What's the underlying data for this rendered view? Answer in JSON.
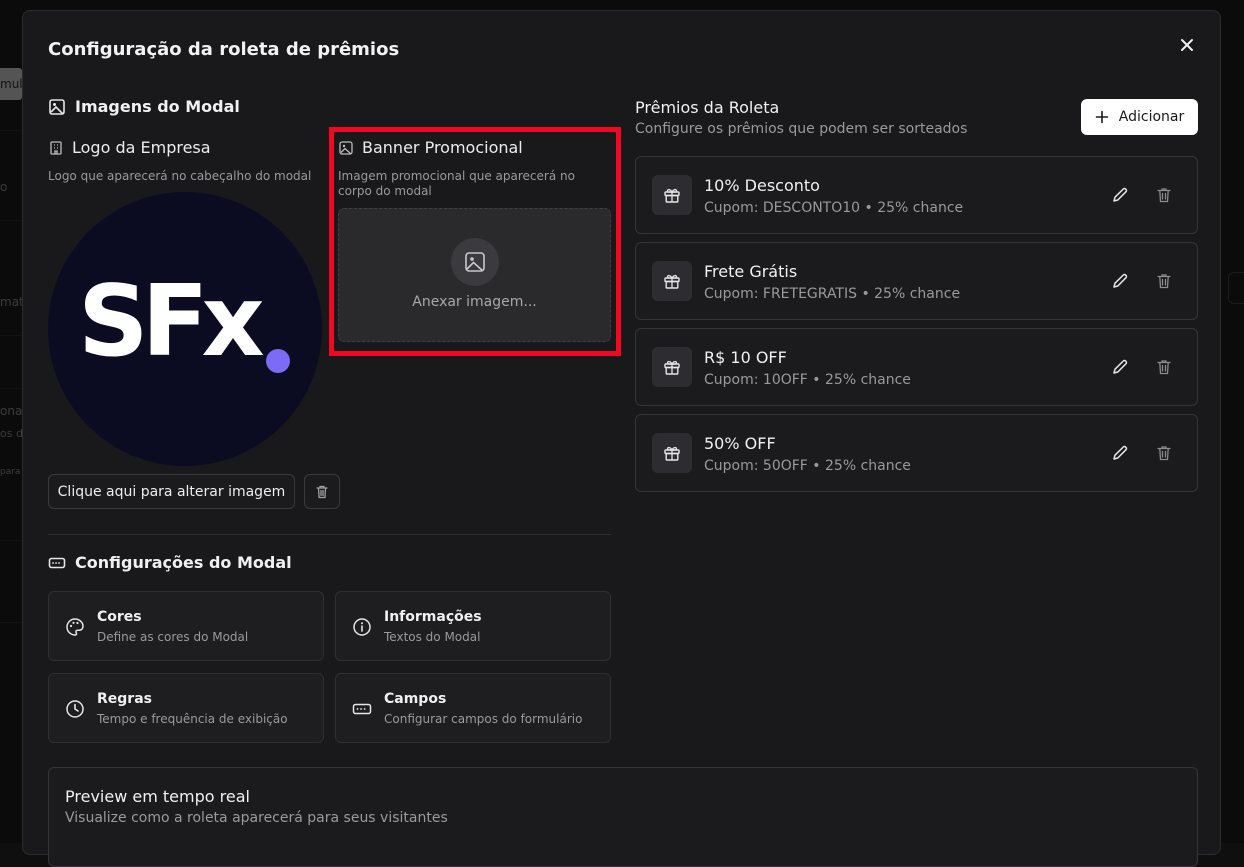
{
  "background": {
    "fragments": [
      "mul",
      "o",
      "mati",
      "ona",
      "os d",
      "para"
    ]
  },
  "modal": {
    "title": "Configuração da roleta de prêmios",
    "images_section": {
      "title": "Imagens do Modal",
      "logo": {
        "label": "Logo da Empresa",
        "hint": "Logo que aparecerá no cabeçalho do modal",
        "logo_text": "SFx",
        "change_button": "Clique aqui para alterar imagem"
      },
      "banner": {
        "label": "Banner Promocional",
        "hint_line1": "Imagem promocional que aparecerá no",
        "hint_line2": "corpo do modal",
        "upload_label": "Anexar imagem..."
      }
    },
    "config_section": {
      "title": "Configurações do Modal",
      "cards": [
        {
          "title": "Cores",
          "desc": "Define as cores do Modal",
          "icon": "palette-icon"
        },
        {
          "title": "Informações",
          "desc": "Textos do Modal",
          "icon": "info-icon"
        },
        {
          "title": "Regras",
          "desc": "Tempo e frequência de exibição",
          "icon": "clock-icon"
        },
        {
          "title": "Campos",
          "desc": "Configurar campos do formulário",
          "icon": "form-field-icon"
        }
      ]
    },
    "prizes": {
      "title": "Prêmios da Roleta",
      "subtitle": "Configure os prêmios que podem ser sorteados",
      "add_button": "Adicionar",
      "items": [
        {
          "name": "10% Desconto",
          "meta": "Cupom: DESCONTO10 • 25% chance"
        },
        {
          "name": "Frete Grátis",
          "meta": "Cupom: FRETEGRATIS • 25% chance"
        },
        {
          "name": "R$ 10 OFF",
          "meta": "Cupom: 10OFF • 25% chance"
        },
        {
          "name": "50% OFF",
          "meta": "Cupom: 50OFF • 25% chance"
        }
      ]
    },
    "preview": {
      "title": "Preview em tempo real",
      "subtitle": "Visualize como a roleta aparecerá para seus visitantes"
    }
  },
  "colors": {
    "highlight": "#ee0a24",
    "modal_bg": "#19191b",
    "logo_bg": "#0b0c22",
    "logo_dot": "#7b6cf6"
  }
}
